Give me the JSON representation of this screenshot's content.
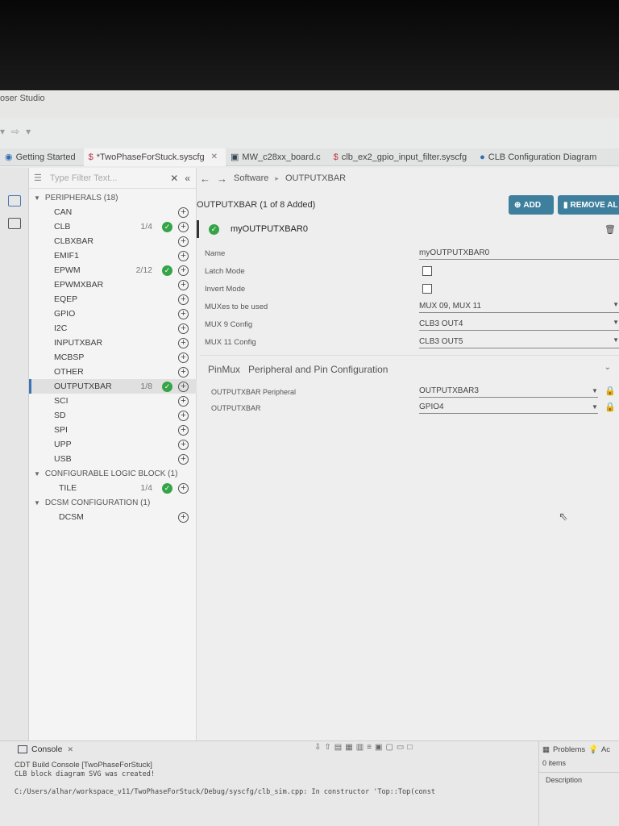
{
  "window": {
    "title": "oser Studio"
  },
  "tabs": [
    {
      "label": "Getting Started",
      "active": false
    },
    {
      "label": "*TwoPhaseForStuck.syscfg",
      "active": true
    },
    {
      "label": "MW_c28xx_board.c",
      "active": false
    },
    {
      "label": "clb_ex2_gpio_input_filter.syscfg",
      "active": false
    },
    {
      "label": "CLB Configuration Diagram",
      "active": false
    }
  ],
  "sidebar": {
    "filter_placeholder": "Type Filter Text...",
    "categories": [
      {
        "label": "PERIPHERALS (18)",
        "items": [
          {
            "label": "CAN"
          },
          {
            "label": "CLB",
            "count": "1/4",
            "ok": true
          },
          {
            "label": "CLBXBAR"
          },
          {
            "label": "EMIF1"
          },
          {
            "label": "EPWM",
            "count": "2/12",
            "ok": true
          },
          {
            "label": "EPWMXBAR"
          },
          {
            "label": "EQEP"
          },
          {
            "label": "GPIO"
          },
          {
            "label": "I2C"
          },
          {
            "label": "INPUTXBAR"
          },
          {
            "label": "MCBSP"
          },
          {
            "label": "OTHER"
          },
          {
            "label": "OUTPUTXBAR",
            "count": "1/8",
            "ok": true,
            "selected": true
          },
          {
            "label": "SCI"
          },
          {
            "label": "SD"
          },
          {
            "label": "SPI"
          },
          {
            "label": "UPP"
          },
          {
            "label": "USB"
          }
        ]
      },
      {
        "label": "CONFIGURABLE LOGIC BLOCK (1)",
        "items": [
          {
            "label": "TILE",
            "count": "1/4",
            "ok": true
          }
        ]
      },
      {
        "label": "DCSM CONFIGURATION (1)",
        "items": [
          {
            "label": "DCSM"
          }
        ]
      }
    ]
  },
  "breadcrumb": {
    "root": "Software",
    "current": "OUTPUTXBAR"
  },
  "module": {
    "title": "OUTPUTXBAR (1 of 8 Added)",
    "add_label": "ADD",
    "remove_label": "REMOVE AL",
    "instance_name": "myOUTPUTXBAR0"
  },
  "properties": {
    "name": {
      "label": "Name",
      "value": "myOUTPUTXBAR0"
    },
    "latch": {
      "label": "Latch Mode"
    },
    "invert": {
      "label": "Invert Mode"
    },
    "muxes": {
      "label": "MUXes to be used",
      "value": "MUX 09, MUX 11"
    },
    "mux9": {
      "label": "MUX 9 Config",
      "value": "CLB3 OUT4"
    },
    "mux11": {
      "label": "MUX 11 Config",
      "value": "CLB3 OUT5"
    }
  },
  "pinmux": {
    "title": "PinMux",
    "subtitle": "Peripheral and Pin Configuration",
    "peripheral": {
      "label": "OUTPUTXBAR Peripheral",
      "value": "OUTPUTXBAR3"
    },
    "pin": {
      "label": "OUTPUTXBAR",
      "value": "GPIO4"
    }
  },
  "console": {
    "tab_label": "Console",
    "line1": "CDT Build Console [TwoPhaseForStuck]",
    "line2": "CLB block diagram SVG was created!",
    "line3": "C:/Users/alhar/workspace_v11/TwoPhaseForStuck/Debug/syscfg/clb_sim.cpp: In constructor 'Top::Top(const"
  },
  "problems": {
    "tab_label": "Problems",
    "tab2_label": "Ac",
    "count_label": "0 items",
    "column_label": "Description"
  }
}
